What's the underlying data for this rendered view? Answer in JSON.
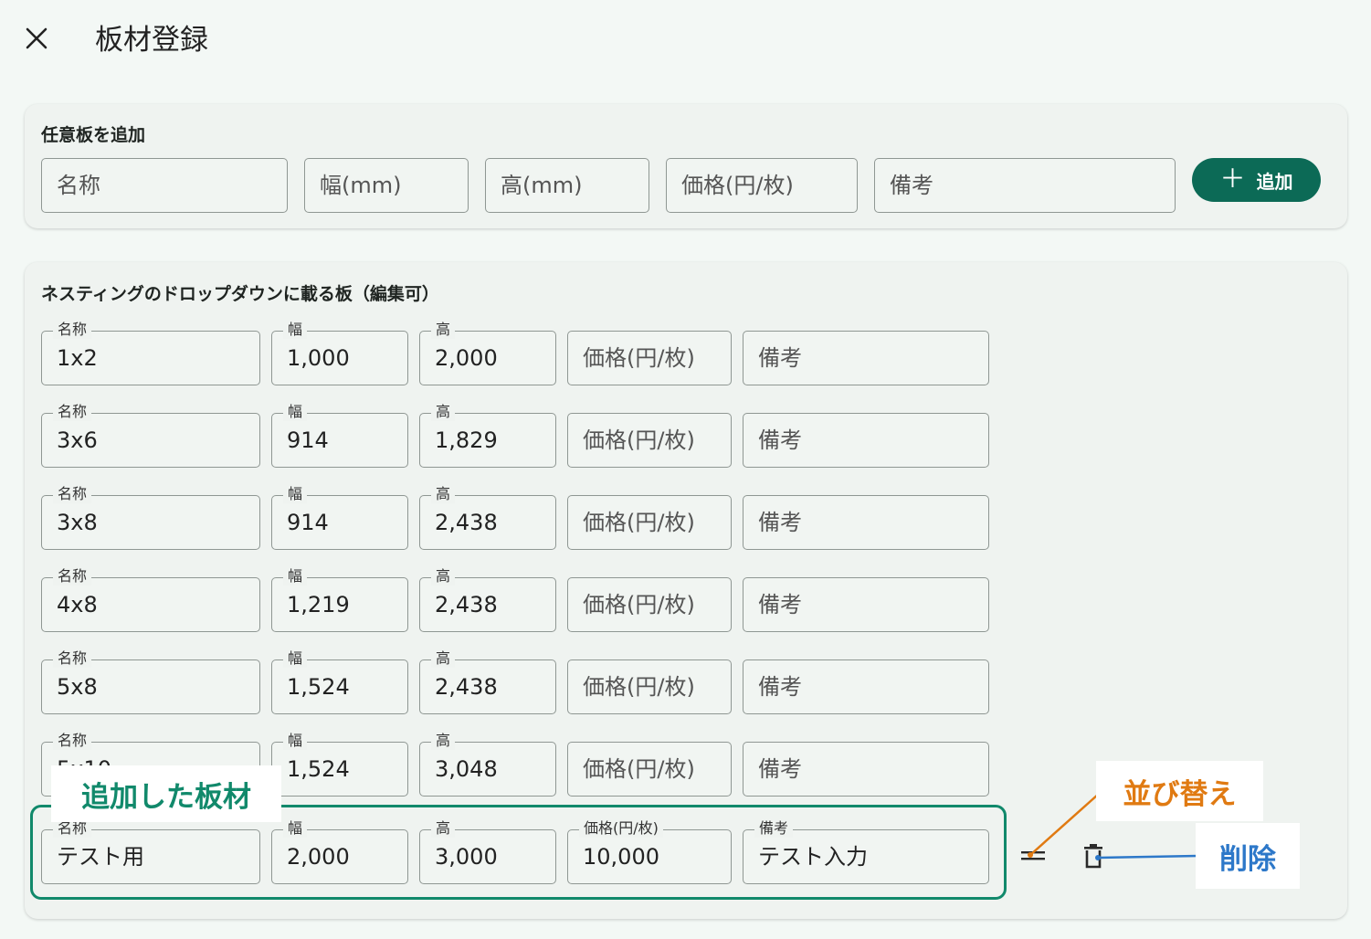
{
  "header": {
    "title": "板材登録",
    "close_icon": "close-icon"
  },
  "add_section": {
    "title": "任意板を追加",
    "fields": [
      {
        "placeholder": "名称"
      },
      {
        "placeholder": "幅(mm)"
      },
      {
        "placeholder": "高(mm)"
      },
      {
        "placeholder": "価格(円/枚)"
      },
      {
        "placeholder": "備考"
      }
    ],
    "add_button": {
      "label": "追加",
      "icon": "plus-icon"
    }
  },
  "list_section": {
    "title": "ネスティングのドロップダウンに載る板（編集可）",
    "labels": {
      "name": "名称",
      "width": "幅",
      "height": "高",
      "price": "価格(円/枚)",
      "note": "備考"
    },
    "rows": [
      {
        "name": "1x2",
        "width": "1,000",
        "height": "2,000",
        "price": "",
        "note": ""
      },
      {
        "name": "3x6",
        "width": "914",
        "height": "1,829",
        "price": "",
        "note": ""
      },
      {
        "name": "3x8",
        "width": "914",
        "height": "2,438",
        "price": "",
        "note": ""
      },
      {
        "name": "4x8",
        "width": "1,219",
        "height": "2,438",
        "price": "",
        "note": ""
      },
      {
        "name": "5x8",
        "width": "1,524",
        "height": "2,438",
        "price": "",
        "note": ""
      },
      {
        "name": "5x10",
        "width": "1,524",
        "height": "3,048",
        "price": "",
        "note": ""
      },
      {
        "name": "テスト用",
        "width": "2,000",
        "height": "3,000",
        "price": "10,000",
        "note": "テスト入力"
      }
    ]
  },
  "row_actions": {
    "sort_icon": "drag-handle-icon",
    "delete_icon": "trash-icon"
  },
  "annotations": {
    "added": "追加した板材",
    "sort": "並び替え",
    "delete": "削除"
  },
  "colors": {
    "primary": "#0c6a56",
    "highlight": "#11896b",
    "annotation_orange": "#e07a12",
    "annotation_blue": "#2d78c9"
  }
}
